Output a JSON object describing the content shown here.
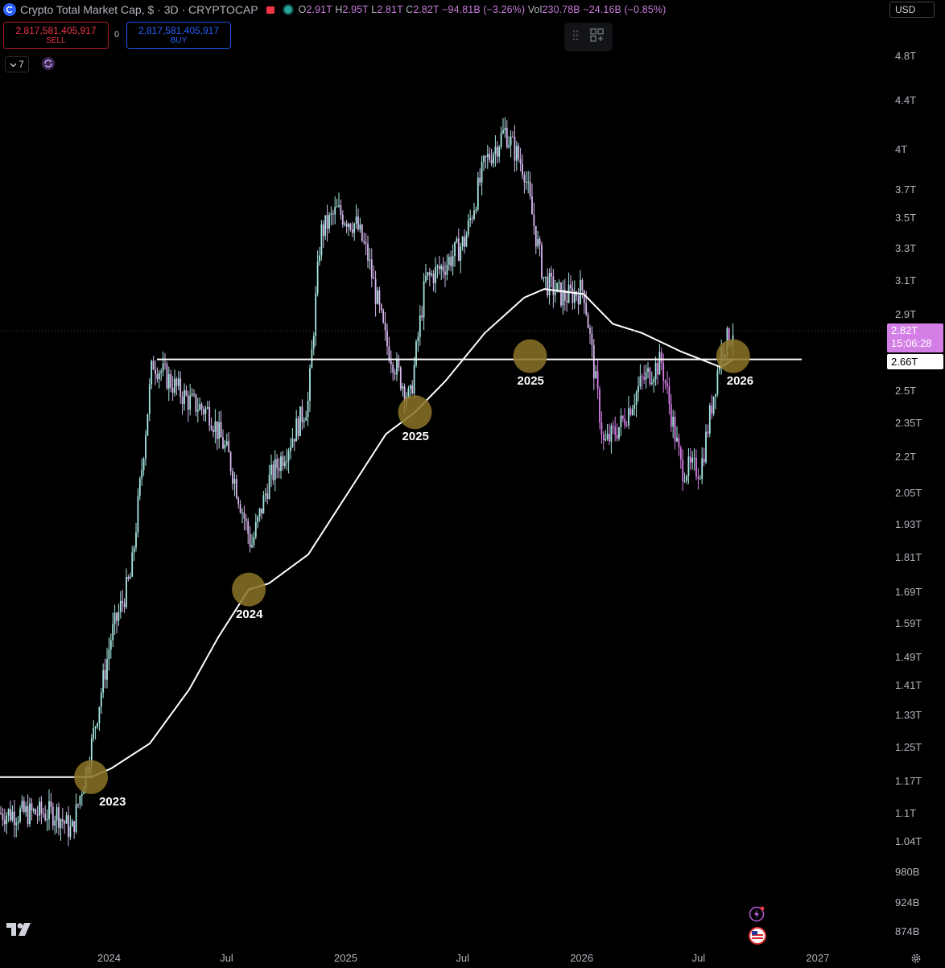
{
  "header": {
    "title": "Crypto Total Market Cap, $ · 3D · CRYPTOCAP",
    "ohlc": {
      "o_label": "O",
      "o_value": "2.91T",
      "h_label": "H",
      "h_value": "2.95T",
      "l_label": "L",
      "l_value": "2.81T",
      "c_label": "C",
      "c_value": "2.82T",
      "change": "−94.81B (−3.26%)",
      "vol_label": "Vol",
      "vol_value": "230.78B",
      "vol_change": "−24.16B (−0.85%)"
    },
    "currency": "USD"
  },
  "trade": {
    "sell_price": "2,817,581,405,917",
    "sell_label": "SELL",
    "spread": "0",
    "buy_price": "2,817,581,405,917",
    "buy_label": "BUY"
  },
  "indicators": {
    "count": "7"
  },
  "price_axis": {
    "ticks": [
      "4.8T",
      "4.4T",
      "4T",
      "3.7T",
      "3.5T",
      "3.3T",
      "3.1T",
      "2.9T",
      "2.5T",
      "2.35T",
      "2.2T",
      "2.05T",
      "1.93T",
      "1.81T",
      "1.69T",
      "1.59T",
      "1.49T",
      "1.41T",
      "1.33T",
      "1.25T",
      "1.17T",
      "1.1T",
      "1.04T",
      "980B",
      "924B",
      "874B"
    ],
    "last_price": "2.82T",
    "countdown": "15:06:28",
    "level_label": "2.66T"
  },
  "time_axis": {
    "ticks": [
      "2024",
      "Jul",
      "2025",
      "Jul",
      "2026",
      "Jul",
      "2027"
    ]
  },
  "annotations": {
    "circle_labels": [
      "2023",
      "2024",
      "2025",
      "2025",
      "2026"
    ]
  },
  "colors": {
    "background": "#000000",
    "candle_up": "#a7e8e2",
    "candle_down": "#d9b8ef",
    "candle_recent": "#d87fe8",
    "moving_average": "#ffffff",
    "horizontal_level": "#ffffff",
    "circle_fill": "#8b7327",
    "last_price": "#d47fe6"
  },
  "icons": [
    "tradingview-logo-icon",
    "refresh-icon",
    "layout-icon",
    "drag-handle-icon",
    "lightning-icon",
    "us-flag-icon",
    "gear-icon"
  ],
  "chart_data": {
    "type": "line",
    "title": "Crypto Total Market Cap, $ · 3D · CRYPTOCAP",
    "x_ticks": [
      "2024",
      "Jul",
      "2025",
      "Jul",
      "2026",
      "Jul",
      "2027"
    ],
    "y_scale": "log",
    "ylim": [
      0.86,
      5.0
    ],
    "series": [
      {
        "x": [
          "2023-10-10",
          "2023-11-01",
          "2023-12-01",
          "2024-01-01",
          "2024-02-01",
          "2024-03-05",
          "2024-04-01",
          "2024-05-01",
          "2024-06-01",
          "2024-07-01",
          "2024-08-05",
          "2024-09-01",
          "2024-10-01",
          "2024-11-01",
          "2024-11-20",
          "2024-12-15",
          "2025-01-15",
          "2025-02-01",
          "2025-03-01",
          "2025-04-07",
          "2025-05-01",
          "2025-06-01",
          "2025-07-01",
          "2025-08-01",
          "2025-08-15",
          "2025-09-01",
          "2025-10-01",
          "2025-10-10",
          "2025-11-01",
          "2025-12-01",
          "2026-01-01",
          "2026-02-01",
          "2026-03-01",
          "2026-04-01",
          "2026-05-01",
          "2026-06-01",
          "2026-07-01",
          "2026-08-01",
          "2026-08-20"
        ],
        "values": [
          1.1,
          1.06,
          1.25,
          1.55,
          1.75,
          2.65,
          2.55,
          2.45,
          2.4,
          2.2,
          1.85,
          2.1,
          2.25,
          2.45,
          3.4,
          3.55,
          3.45,
          3.25,
          2.75,
          2.45,
          3.1,
          3.2,
          3.35,
          3.9,
          4.0,
          4.15,
          3.85,
          3.6,
          3.1,
          3.0,
          3.05,
          2.25,
          2.35,
          2.55,
          2.65,
          2.15,
          2.15,
          2.7,
          2.82
        ]
      },
      {
        "x": [
          "2023-10-10",
          "2023-12-01",
          "2024-01-01",
          "2024-03-01",
          "2024-05-01",
          "2024-06-15",
          "2024-08-01",
          "2024-09-01",
          "2024-11-01",
          "2025-01-01",
          "2025-03-01",
          "2025-04-15",
          "2025-06-01",
          "2025-08-01",
          "2025-10-01",
          "2025-11-01",
          "2026-01-01",
          "2026-02-15",
          "2026-04-01",
          "2026-06-01",
          "2026-08-01",
          "2026-08-20"
        ],
        "values": [
          1.18,
          1.18,
          1.2,
          1.26,
          1.4,
          1.55,
          1.7,
          1.72,
          1.82,
          2.05,
          2.3,
          2.4,
          2.55,
          2.8,
          3.0,
          3.05,
          3.02,
          2.85,
          2.8,
          2.7,
          2.62,
          2.66
        ]
      }
    ],
    "horizontal_level": 2.66,
    "circled_years": [
      "2023",
      "2024",
      "2025",
      "2025",
      "2026"
    ]
  }
}
